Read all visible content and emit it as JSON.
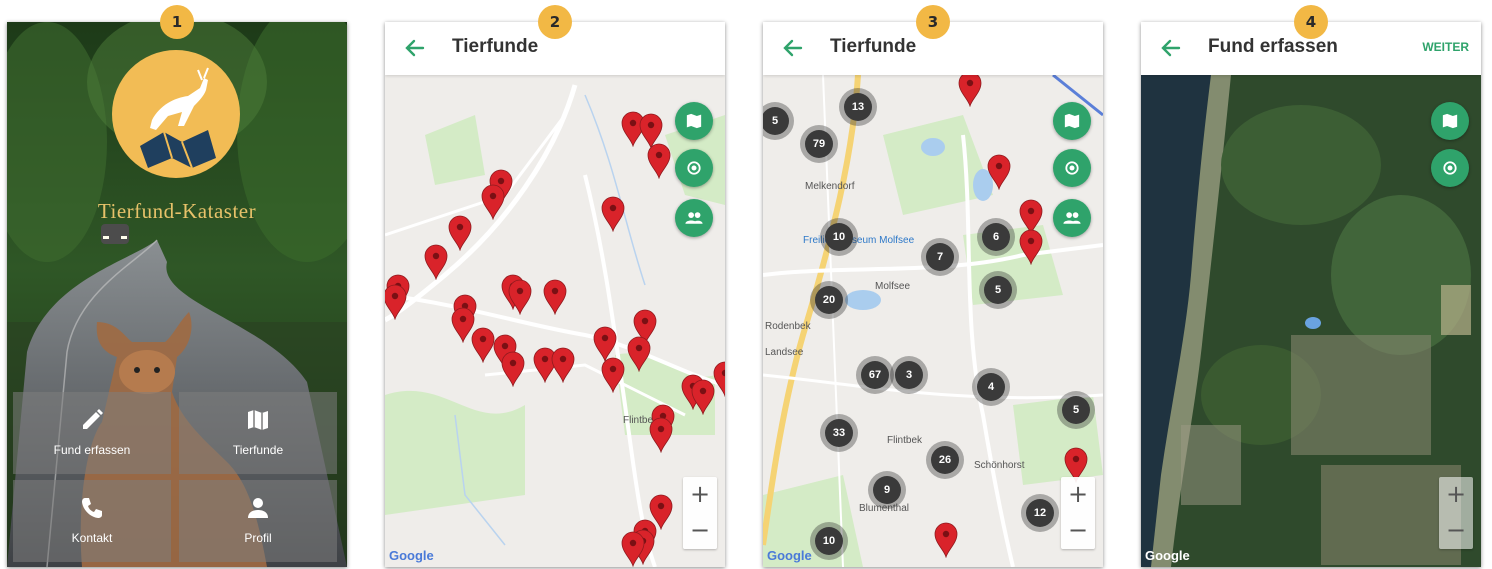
{
  "steps": [
    "1",
    "2",
    "3",
    "4"
  ],
  "screen1": {
    "title": "Tierfund-Kataster",
    "tiles": [
      {
        "label": "Fund erfassen",
        "icon": "pencil-icon"
      },
      {
        "label": "Tierfunde",
        "icon": "map-icon"
      },
      {
        "label": "Kontakt",
        "icon": "phone-icon"
      },
      {
        "label": "Profil",
        "icon": "person-icon"
      }
    ]
  },
  "screen2": {
    "title": "Tierfunde",
    "fab_icons": [
      "map-icon",
      "locate-icon",
      "group-icon"
    ],
    "zoom_in": "+",
    "zoom_out": "−",
    "map_labels": [
      "Flintbek"
    ],
    "brand": "Google"
  },
  "screen3": {
    "title": "Tierfunde",
    "fab_icons": [
      "map-icon",
      "locate-icon",
      "group-icon"
    ],
    "zoom_in": "+",
    "zoom_out": "−",
    "clusters": [
      "13",
      "5",
      "79",
      "10",
      "7",
      "6",
      "5",
      "20",
      "67",
      "3",
      "4",
      "5",
      "33",
      "26",
      "9",
      "12",
      "10"
    ],
    "map_labels": [
      "Melkendorf",
      "Freilichtmuseum Molfsee",
      "Molfsee",
      "Flintbek",
      "Schönhorst",
      "Blumenthal",
      "Rodenbek",
      "Landsee"
    ],
    "brand": "Google"
  },
  "screen4": {
    "title": "Fund erfassen",
    "action": "WEITER",
    "fab_icons": [
      "map-icon",
      "locate-icon"
    ],
    "zoom_in": "+",
    "zoom_out": "−",
    "brand": "Google"
  },
  "colors": {
    "accent_green": "#2fa36b",
    "badge_yellow": "#f2b845",
    "pin_red": "#d9232a",
    "cluster_dark": "#3a3a3a"
  }
}
